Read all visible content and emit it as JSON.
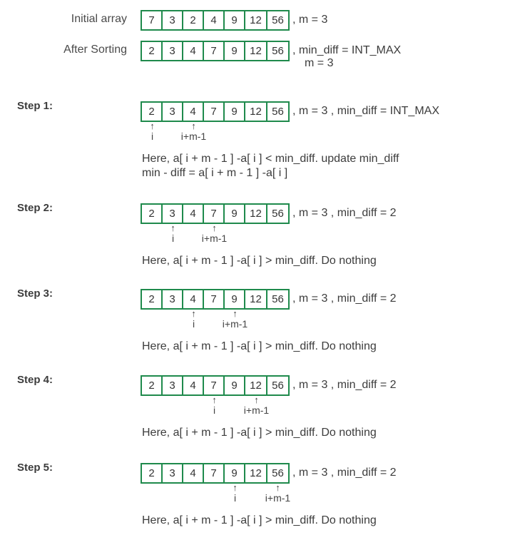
{
  "initial": {
    "label": "Initial array",
    "values": [
      "7",
      "3",
      "2",
      "4",
      "9",
      "12",
      "56"
    ],
    "info": ",  m = 3"
  },
  "sorted": {
    "label": "After Sorting",
    "values": [
      "2",
      "3",
      "4",
      "7",
      "9",
      "12",
      "56"
    ],
    "info_line1": ",  min_diff = INT_MAX",
    "info_line2": "m = 3"
  },
  "steps": [
    {
      "label": "Step 1:",
      "values": [
        "2",
        "3",
        "4",
        "7",
        "9",
        "12",
        "56"
      ],
      "info": ",  m = 3 , min_diff = INT_MAX",
      "i_index": 0,
      "j_index": 2,
      "i_label": "i",
      "j_label": "i+m-1",
      "notes": [
        "Here, a[ i + m - 1 ] -a[ i ] < min_diff. update min_diff",
        "min - diff = a[ i + m - 1 ] -a[ i ]"
      ]
    },
    {
      "label": "Step 2:",
      "values": [
        "2",
        "3",
        "4",
        "7",
        "9",
        "12",
        "56"
      ],
      "info": ",  m = 3 , min_diff = 2",
      "i_index": 1,
      "j_index": 3,
      "i_label": "i",
      "j_label": "i+m-1",
      "notes": [
        "Here, a[ i + m - 1 ] -a[ i ] > min_diff. Do nothing"
      ]
    },
    {
      "label": "Step 3:",
      "values": [
        "2",
        "3",
        "4",
        "7",
        "9",
        "12",
        "56"
      ],
      "info": ",  m = 3 , min_diff = 2",
      "i_index": 2,
      "j_index": 4,
      "i_label": "i",
      "j_label": "i+m-1",
      "notes": [
        "Here, a[ i + m - 1 ] -a[ i ] > min_diff. Do nothing"
      ]
    },
    {
      "label": "Step 4:",
      "values": [
        "2",
        "3",
        "4",
        "7",
        "9",
        "12",
        "56"
      ],
      "info": ",  m = 3 , min_diff = 2",
      "i_index": 3,
      "j_index": 5,
      "i_label": "i",
      "j_label": "i+m-1",
      "notes": [
        "Here, a[ i + m - 1 ] -a[ i ] > min_diff. Do nothing"
      ]
    },
    {
      "label": "Step 5:",
      "values": [
        "2",
        "3",
        "4",
        "7",
        "9",
        "12",
        "56"
      ],
      "info": ",  m = 3 , min_diff = 2",
      "i_index": 4,
      "j_index": 6,
      "i_label": "i",
      "j_label": "i+m-1",
      "notes": [
        "Here, a[ i + m - 1 ] -a[ i ] > min_diff. Do nothing"
      ]
    }
  ],
  "colors": {
    "cell_border": "#1f8a4c",
    "text": "#3c3c3c"
  },
  "arrow_glyph": "↑"
}
